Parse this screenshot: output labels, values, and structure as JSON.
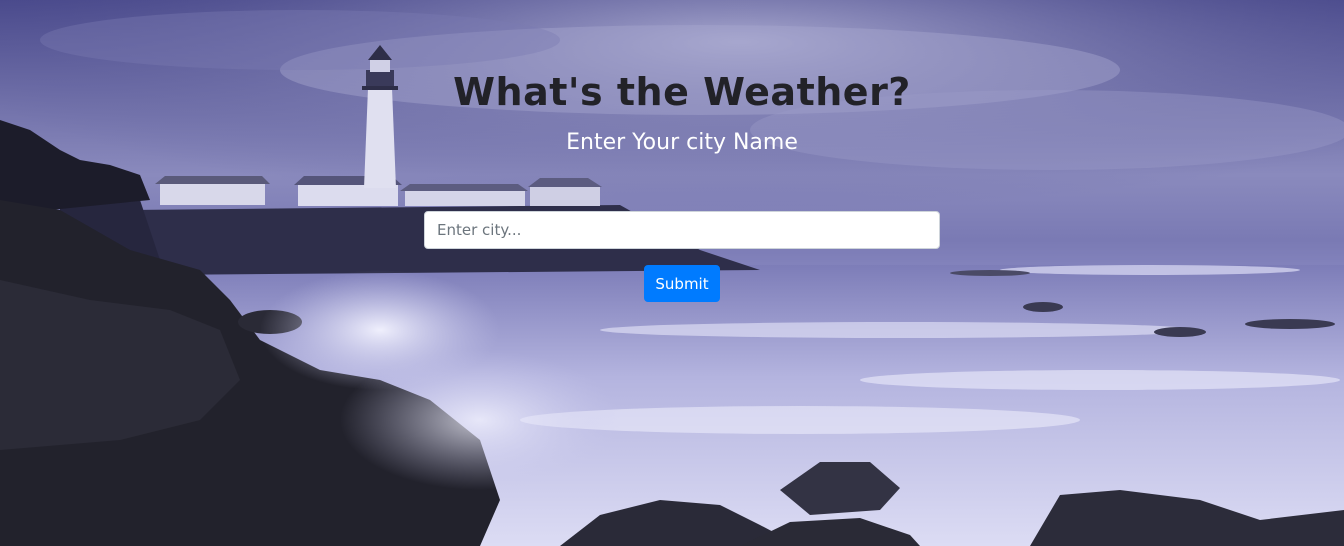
{
  "page": {
    "title": "What's the Weather?",
    "subtitle": "Enter Your city Name"
  },
  "form": {
    "city_placeholder": "Enter city...",
    "city_value": "",
    "submit_label": "Submit"
  },
  "colors": {
    "submit_bg": "#007bff",
    "title_color": "#222228",
    "subtitle_color": "#ffffff"
  },
  "background": {
    "description_icon": "lighthouse-seascape-image"
  }
}
